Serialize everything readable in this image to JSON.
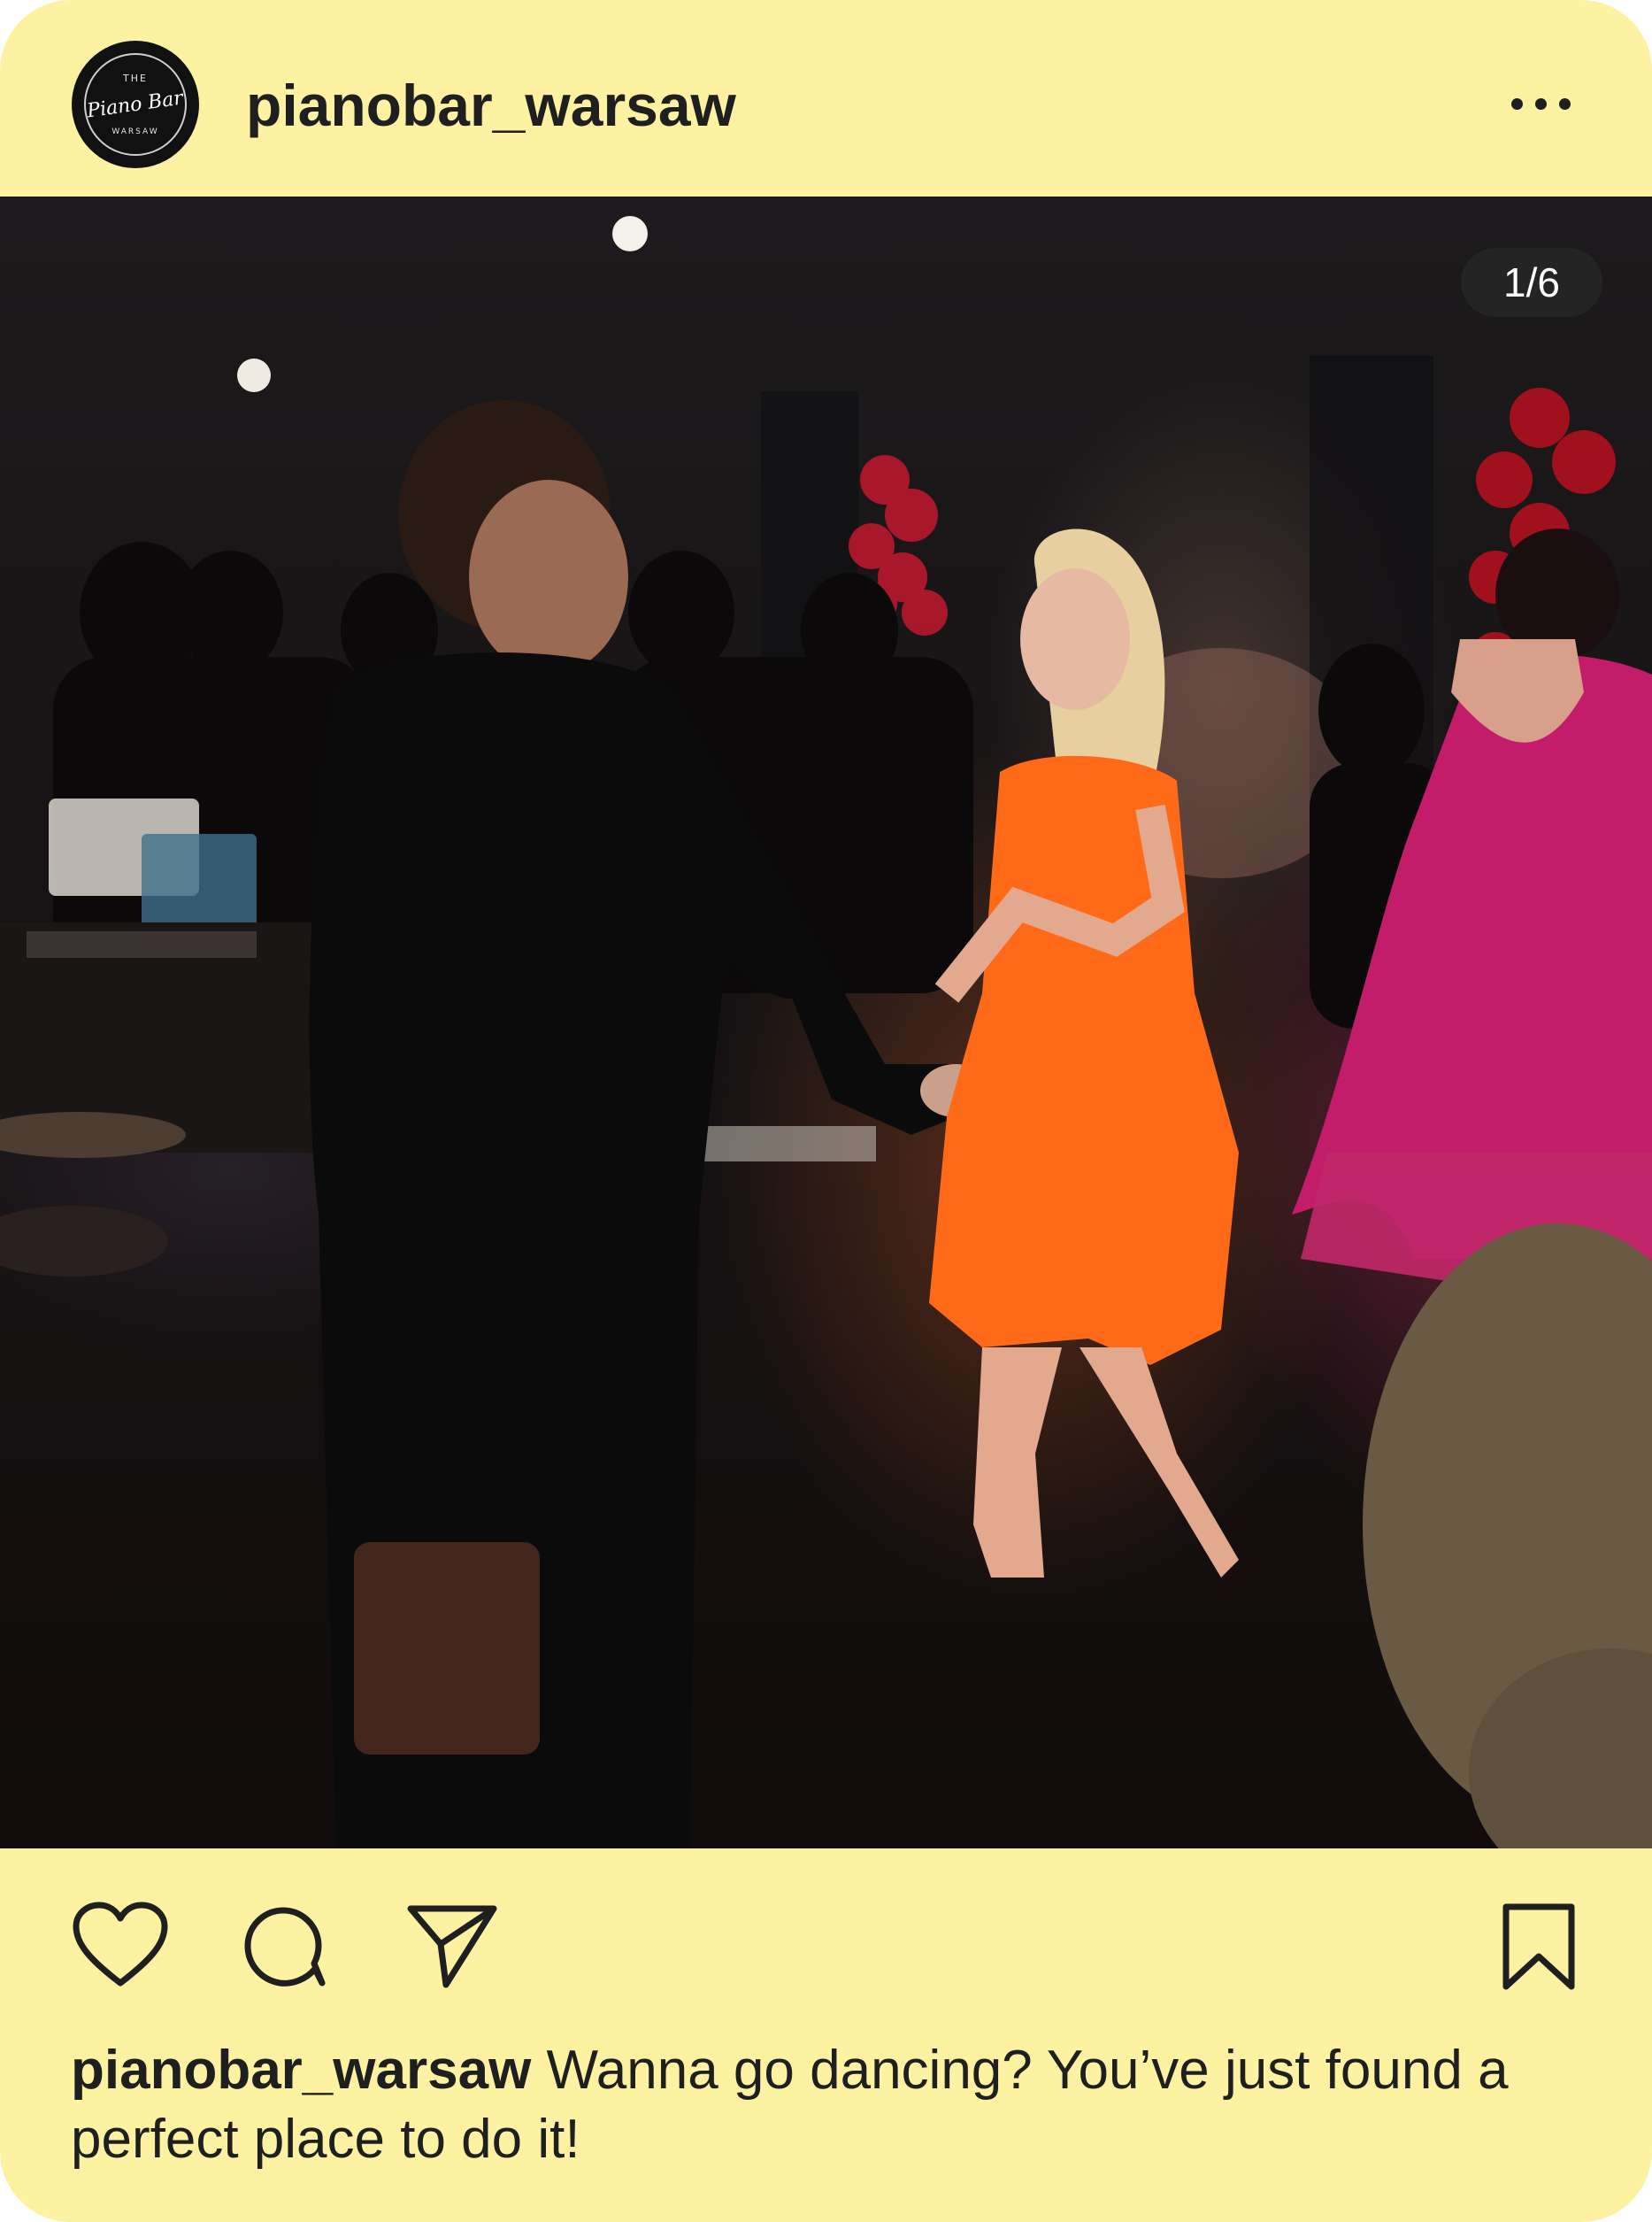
{
  "post": {
    "username": "pianobar_warsaw",
    "avatar": {
      "logo_top": "THE",
      "logo_main": "Piano Bar",
      "logo_bottom": "WARSAW"
    },
    "more_icon": "more-horizontal-icon",
    "image": {
      "description_icon": "photo",
      "counter": "1/6"
    },
    "actions": {
      "like_icon": "heart-icon",
      "comment_icon": "comment-icon",
      "share_icon": "send-icon",
      "save_icon": "bookmark-icon"
    },
    "caption": {
      "username": "pianobar_warsaw",
      "text": "Wanna go dancing? You’ve just found a perfect place to do it!"
    }
  },
  "colors": {
    "card_background": "#fdf2a2",
    "text": "#1f1f1f"
  }
}
